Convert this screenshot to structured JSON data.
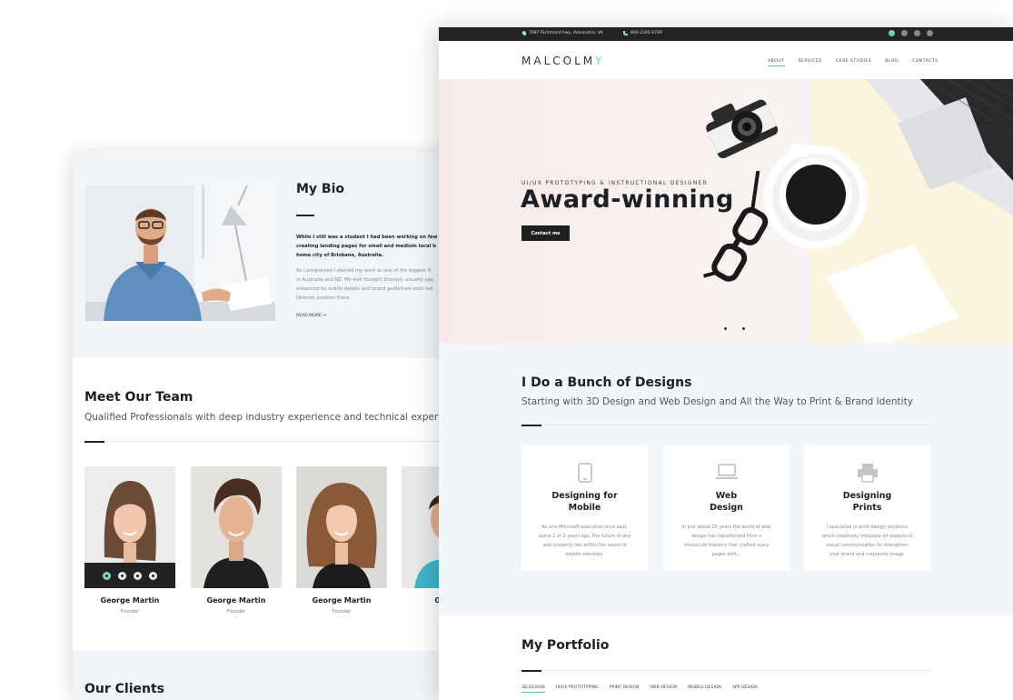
{
  "colors": {
    "accent": "#7fcdd8",
    "dark": "#1d1f26",
    "panel": "#f2f5fa",
    "topbar": "#232323"
  },
  "back_page": {
    "bio": {
      "title": "My Bio",
      "text_1": [
        "While I still was a student I had been working on few c",
        "creating landing pages for small and medium local b",
        "home city of Brisbane, Australia."
      ],
      "text_2": [
        "As I progressed I started my work at one of the biggest fi",
        "in Australia and NZ. My well thought through, visually app",
        "enhanced by subtle details and brand guidelines soon led",
        "Director position there..."
      ],
      "read_more": "READ MORE ⇒"
    },
    "team": {
      "title": "Meet Our Team",
      "subtitle": "Qualified Professionals with deep industry experience and technical expertise.",
      "members": [
        {
          "name": "George Martin",
          "role": "Founder"
        },
        {
          "name": "George Martin",
          "role": "Founder"
        },
        {
          "name": "George Martin",
          "role": "Founder"
        },
        {
          "name": "Georg",
          "role": ""
        }
      ]
    },
    "clients": {
      "title": "Our Clients"
    }
  },
  "front_page": {
    "topbar": {
      "address": "7087 Richmond hwy, Alexandria, VA",
      "phone": "800-2345-6789"
    },
    "logo": {
      "main": "MALCOLM",
      "accent": "Y"
    },
    "nav": [
      "ABOUT",
      "SERVICES",
      "CASE STUDIES",
      "BLOG",
      "CONTACTS"
    ],
    "nav_active": "ABOUT",
    "hero": {
      "eyebrow": "UI/UX PROTOTYPING & INSTRUCTIONAL DESIGNER",
      "title": "Award-winning",
      "button": "Contact me"
    },
    "designs": {
      "title": "I Do a Bunch of Designs",
      "subtitle": "Starting with 3D Design and Web Design and All the Way to Print & Brand Identity",
      "cards": [
        {
          "icon": "mobile-icon",
          "title": [
            "Designing for",
            "Mobile"
          ],
          "text": [
            "As one Microsoft executive once said,",
            "some 2 or 3 years ago, the future of any",
            "web property lies within the realm of",
            "mobile websites."
          ]
        },
        {
          "icon": "laptop-icon",
          "title": [
            "Web",
            "Design"
          ],
          "text": [
            "In just about 20 years the world of web",
            "design has transformed from a",
            "minuscule industry that crafted scary",
            "pages with..."
          ]
        },
        {
          "icon": "printer-icon",
          "title": [
            "Designing",
            "Prints"
          ],
          "text": [
            "I specialize in print design solutions",
            "which creatively integrate all aspects of",
            "visual communication to strengthen",
            "your brand and corporate image."
          ]
        }
      ]
    },
    "portfolio": {
      "title": "My Portfolio",
      "filters": [
        "3D DESIGN",
        "UI/UX PROTOTYPING",
        "PRINT DESIGN",
        "WEB DESIGN",
        "MOBILE DESIGN",
        "APP DESIGN"
      ]
    }
  }
}
